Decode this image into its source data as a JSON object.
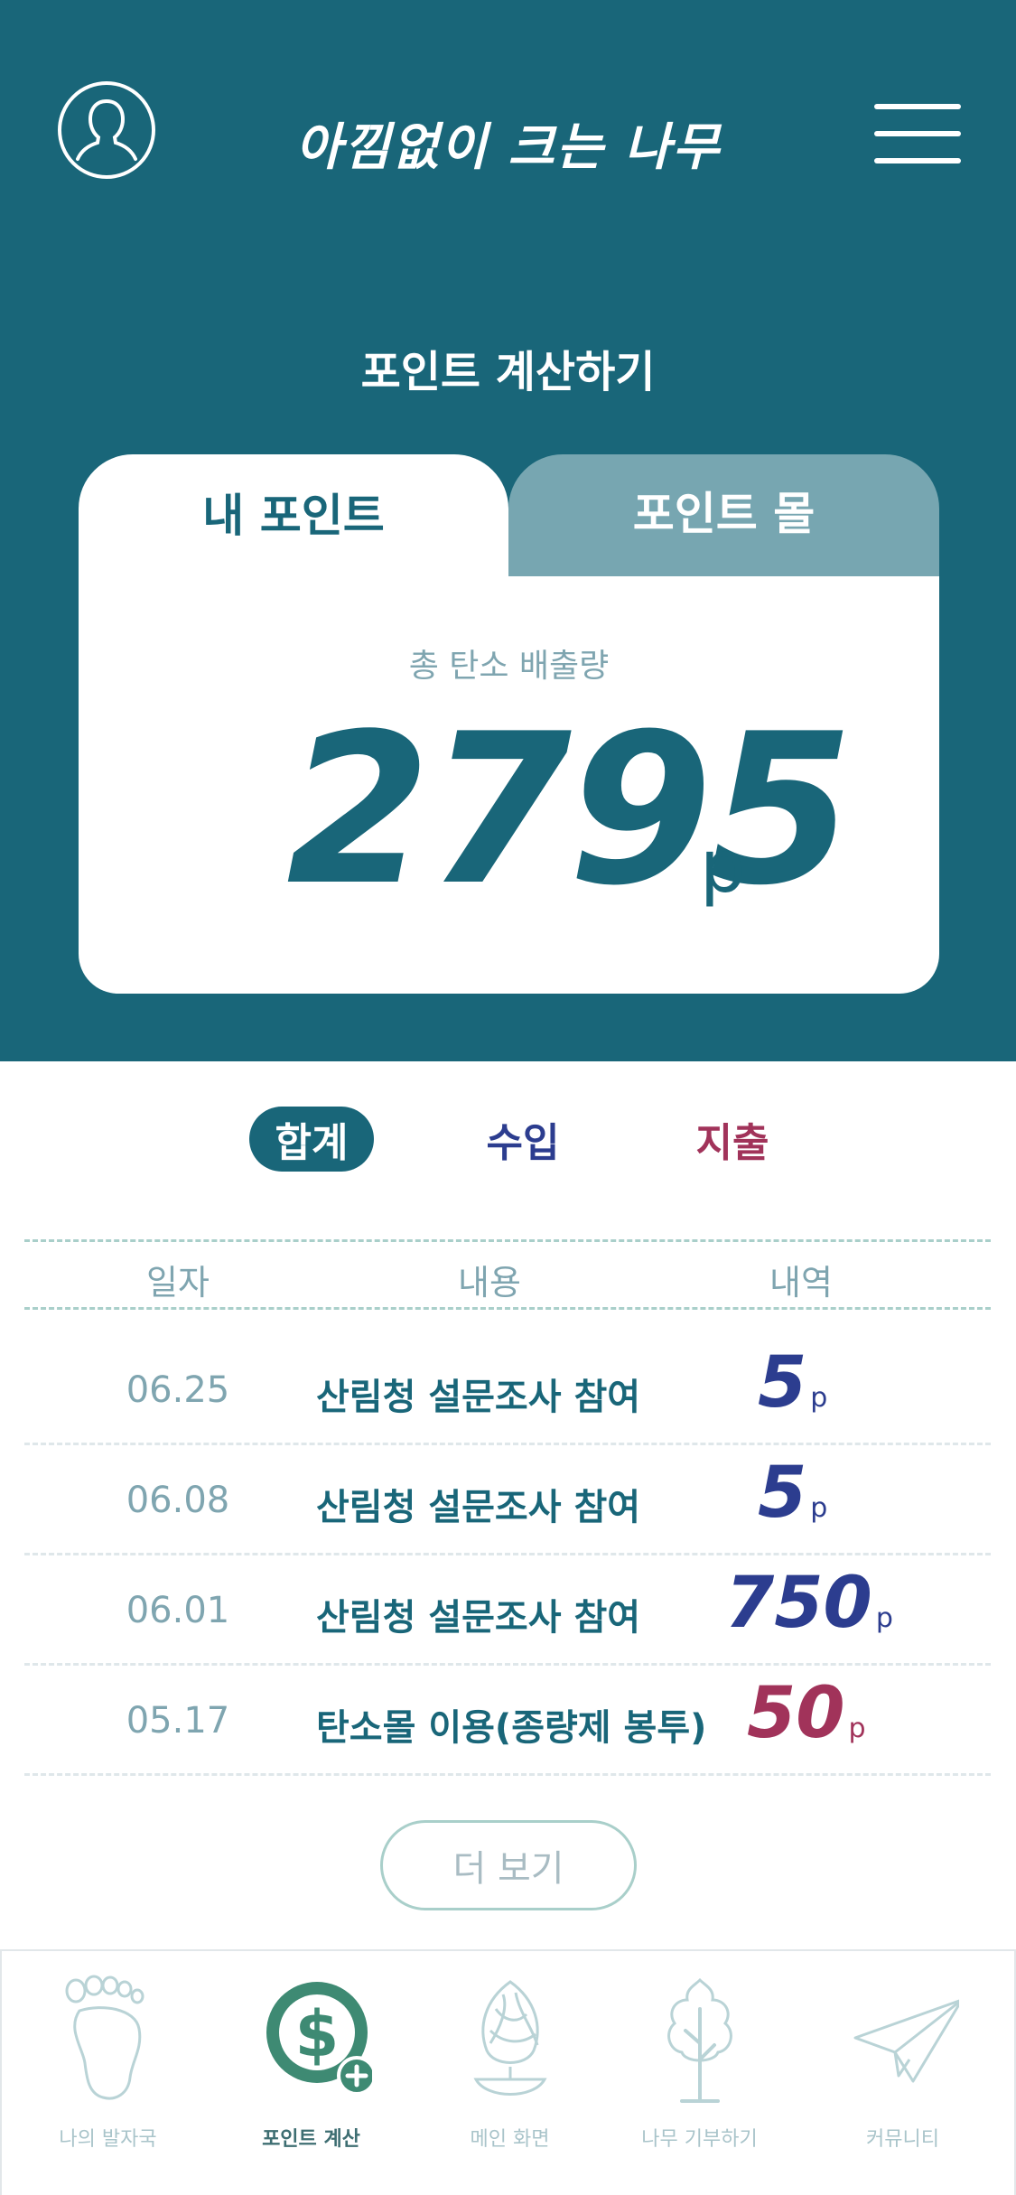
{
  "header": {
    "brand": "아낌없이 크는 나무",
    "profile_icon": "user-profile-icon",
    "menu_icon": "hamburger-menu-icon"
  },
  "page": {
    "title": "포인트 계산하기"
  },
  "tabs": [
    {
      "label": "내 포인트",
      "active": true
    },
    {
      "label": "포인트 몰",
      "active": false
    }
  ],
  "summary": {
    "label": "총 탄소 배출량",
    "value": "2795",
    "unit": "p"
  },
  "filters": {
    "total": "합계",
    "income": "수입",
    "expense": "지출"
  },
  "table": {
    "headers": [
      "일자",
      "내용",
      "내역"
    ],
    "rows": [
      {
        "date": "06.25",
        "desc": "산림청 설문조사 참여",
        "amount": "5",
        "unit": "p",
        "type": "income"
      },
      {
        "date": "06.08",
        "desc": "산림청 설문조사 참여",
        "amount": "5",
        "unit": "p",
        "type": "income"
      },
      {
        "date": "06.01",
        "desc": "산림청 설문조사 참여",
        "amount": "750",
        "unit": "p",
        "type": "income"
      },
      {
        "date": "05.17",
        "desc": "탄소몰 이용(종량제 봉투)",
        "amount": "50",
        "unit": "p",
        "type": "expense"
      }
    ]
  },
  "more_button": "더 보기",
  "colors": {
    "primary": "#196679",
    "income": "#2c3d8f",
    "expense": "#a1335a",
    "accent_green": "#3e8a73"
  },
  "bottom_nav": [
    {
      "label": "나의 발자국",
      "icon": "footprint-icon",
      "active": false
    },
    {
      "label": "포인트 계산",
      "icon": "dollar-coin-icon",
      "active": true
    },
    {
      "label": "메인 화면",
      "icon": "leaf-seed-icon",
      "active": false
    },
    {
      "label": "나무 기부하기",
      "icon": "tree-icon",
      "active": false
    },
    {
      "label": "커뮤니티",
      "icon": "paper-plane-icon",
      "active": false
    }
  ]
}
